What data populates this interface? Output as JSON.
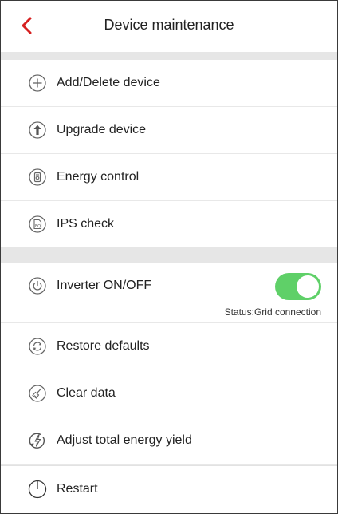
{
  "header": {
    "title": "Device maintenance"
  },
  "group1": [
    {
      "label": "Add/Delete device",
      "icon": "plus-circle-icon"
    },
    {
      "label": "Upgrade device",
      "icon": "upgrade-arrow-icon"
    },
    {
      "label": "Energy control",
      "icon": "energy-control-icon"
    },
    {
      "label": "IPS check",
      "icon": "ips-check-icon"
    }
  ],
  "group2": {
    "inverter": {
      "label": "Inverter ON/OFF",
      "icon": "power-icon",
      "toggle_on": true,
      "status": "Status:Grid connection"
    },
    "items": [
      {
        "label": "Restore defaults",
        "icon": "restore-icon"
      },
      {
        "label": "Clear data",
        "icon": "clear-data-icon"
      },
      {
        "label": "Adjust total energy yield",
        "icon": "energy-yield-icon"
      },
      {
        "label": "Restart",
        "icon": "restart-icon"
      }
    ]
  },
  "colors": {
    "accent": "#d62020",
    "toggle_on": "#5fd068",
    "divider": "#e6e6e6",
    "icon_stroke": "#666666"
  }
}
